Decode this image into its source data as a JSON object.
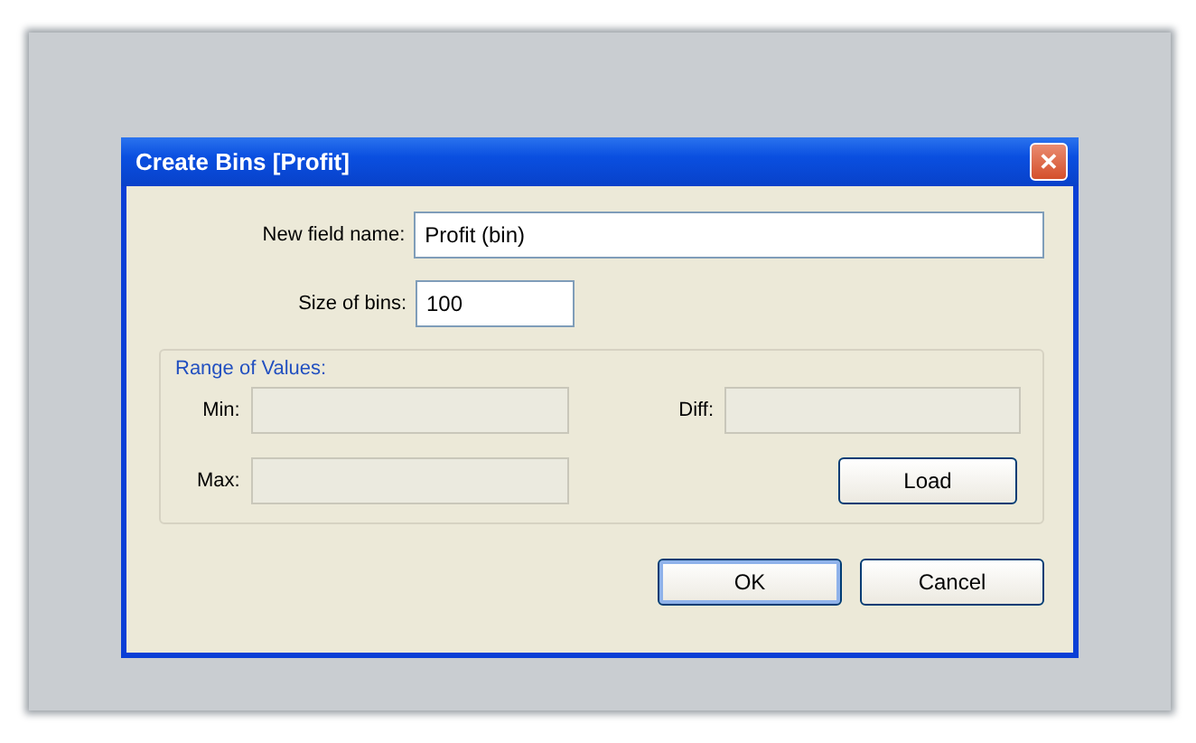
{
  "window": {
    "title": "Create Bins [Profit]",
    "close": "✕"
  },
  "fields": [
    {
      "label": "New field name:",
      "value": "Profit (bin)"
    },
    {
      "label": "Size of bins:",
      "value": "100"
    }
  ],
  "range_group": {
    "title": "Range of Values:",
    "fields": [
      {
        "label": "Min:",
        "disabled": true
      },
      {
        "label": "Diff:",
        "disabled": true
      },
      {
        "label": "Max:",
        "disabled": true
      }
    ],
    "button": {
      "label": "Load"
    }
  },
  "buttons": [
    {
      "label": "OK",
      "default": true
    },
    {
      "label": "Cancel",
      "default": false
    }
  ]
}
